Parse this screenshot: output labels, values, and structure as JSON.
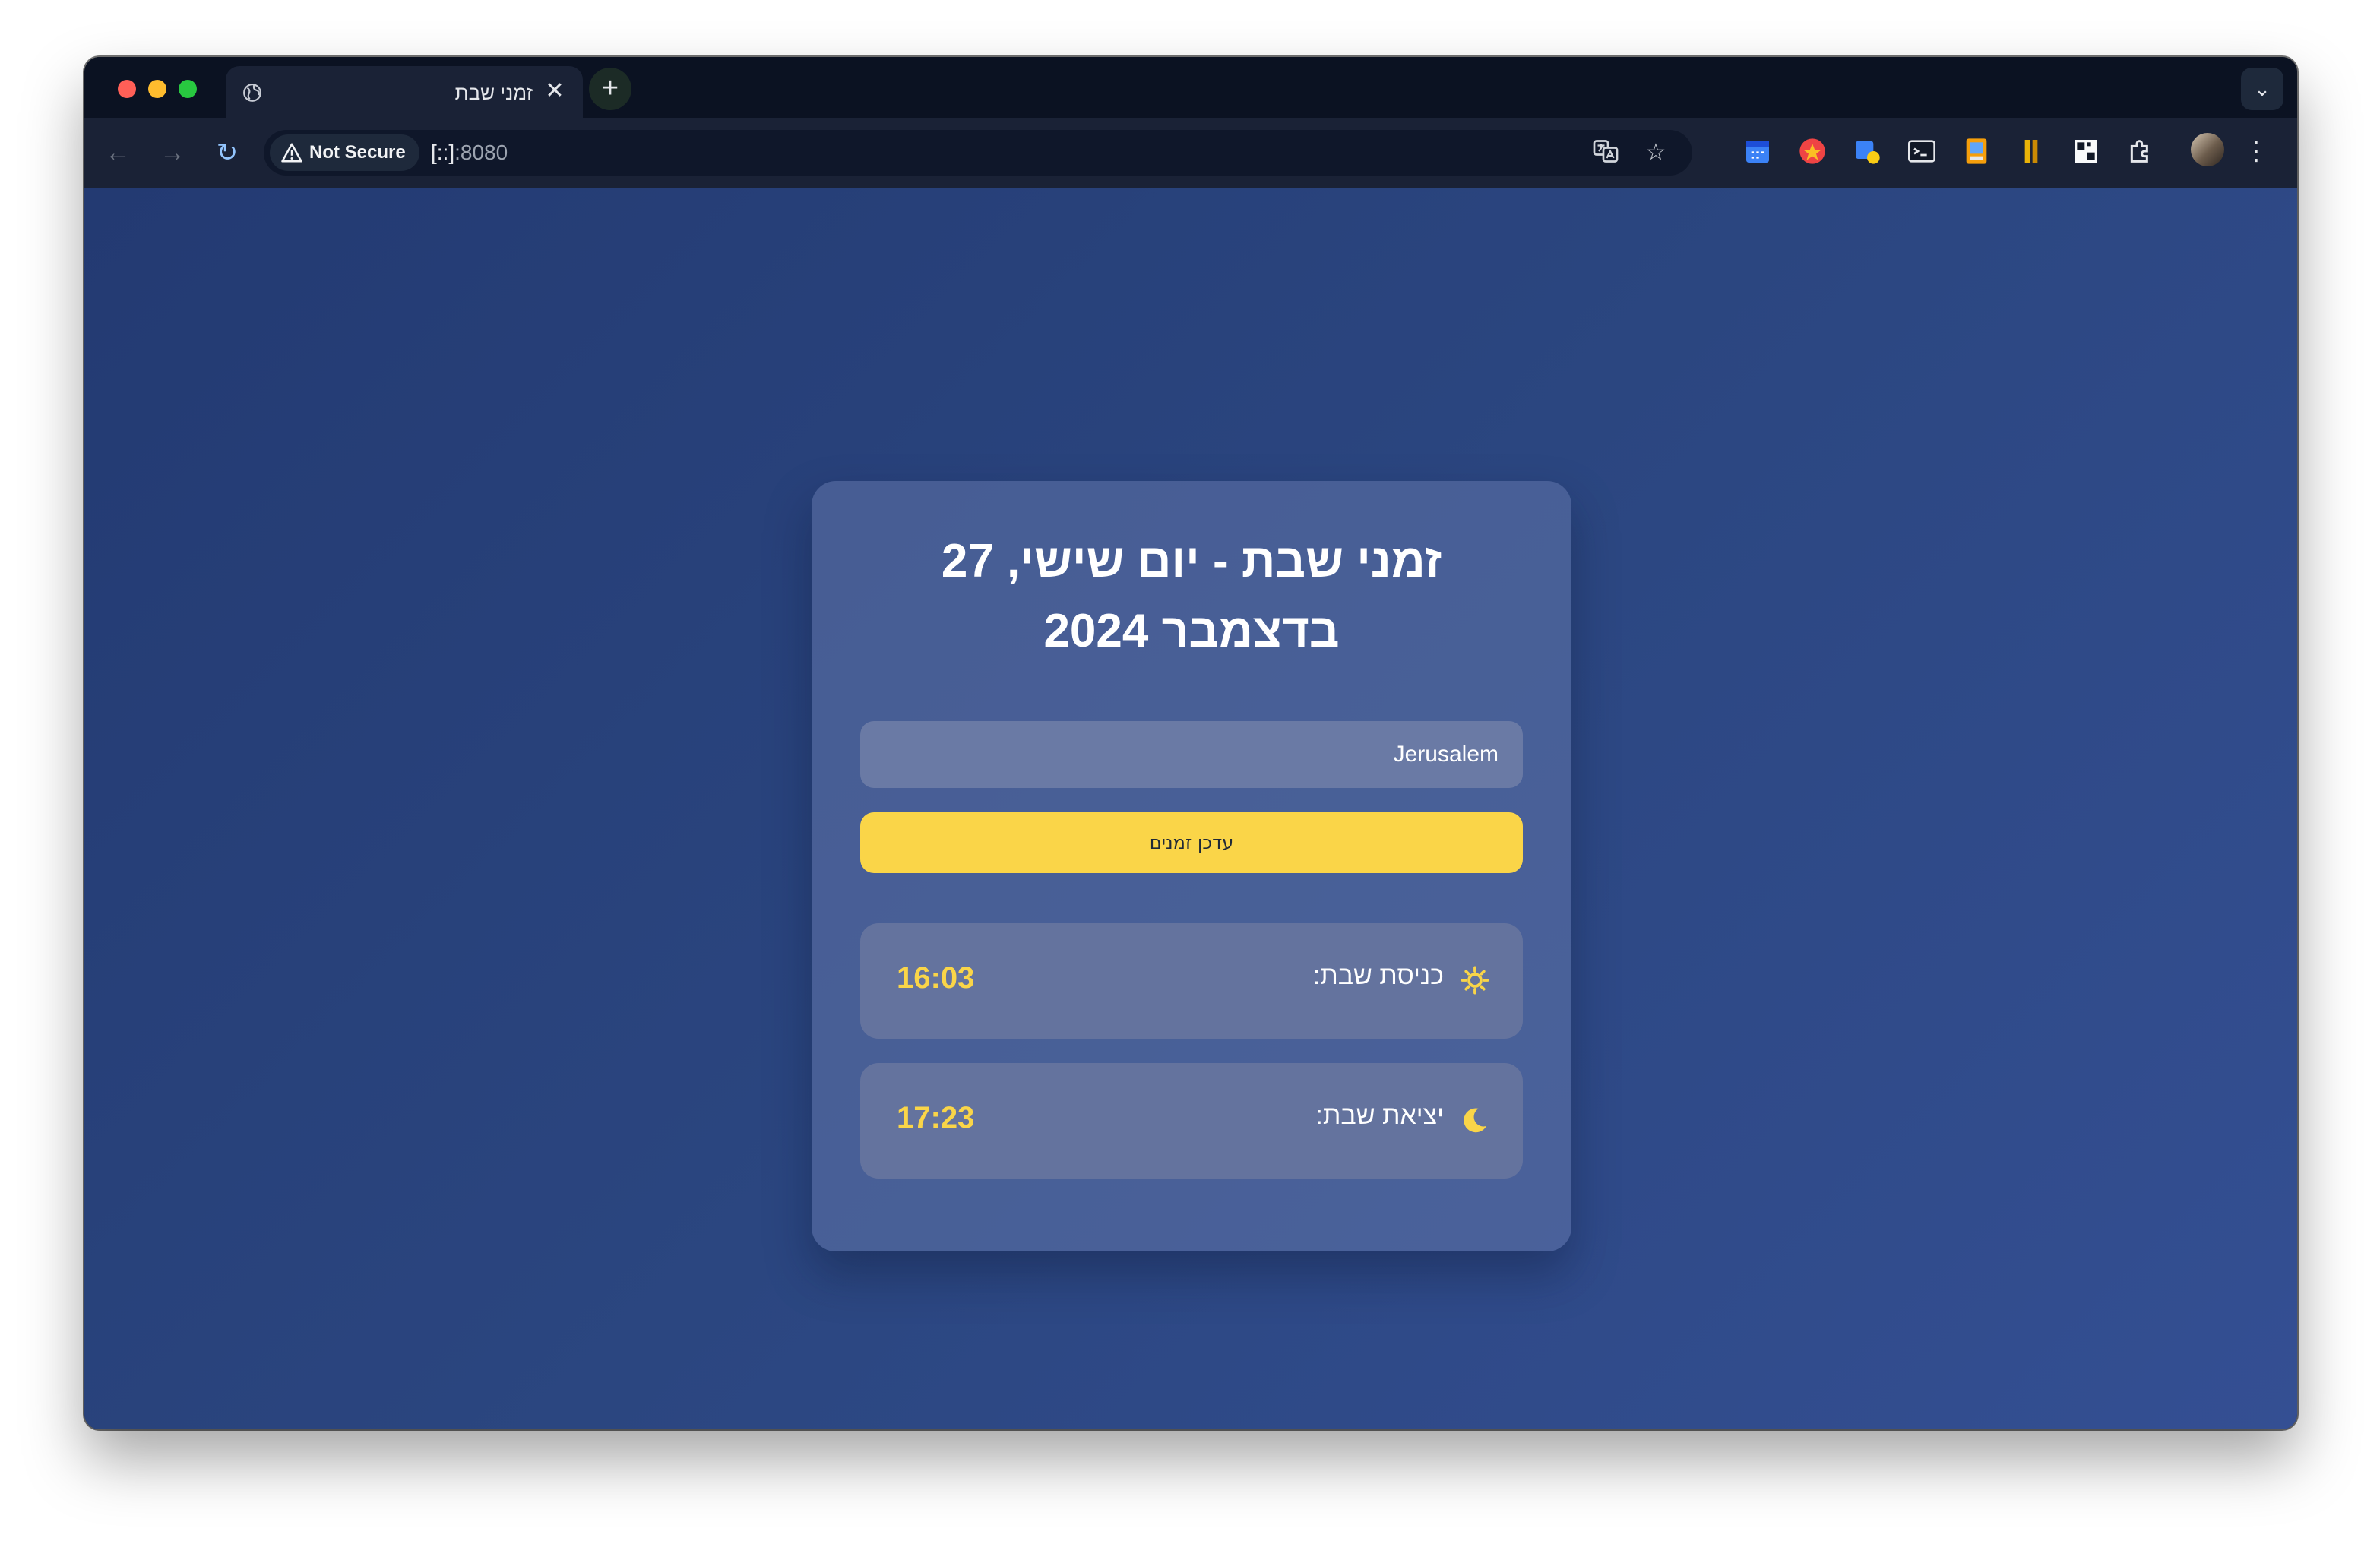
{
  "browser": {
    "tab_title": "זמני שבת",
    "tab_close": "✕",
    "new_tab": "+",
    "tab_menu": "⌄",
    "security_label": "Not Secure",
    "url_host": "[::]",
    "url_port": ":8080"
  },
  "page": {
    "title": "זמני שבת - יום שישי, 27 בדצמבר 2024",
    "city_value": "Jerusalem",
    "update_button": "עדכן זמנים",
    "candle_lighting": {
      "label": "כניסת שבת:",
      "time": "16:03",
      "icon": "sun-icon"
    },
    "havdalah": {
      "label": "יציאת שבת:",
      "time": "17:23",
      "icon": "moon-icon"
    }
  },
  "colors": {
    "accent": "#fad548",
    "background": "#2b4680",
    "card": "#5a6ca0",
    "row": "#64739e"
  }
}
